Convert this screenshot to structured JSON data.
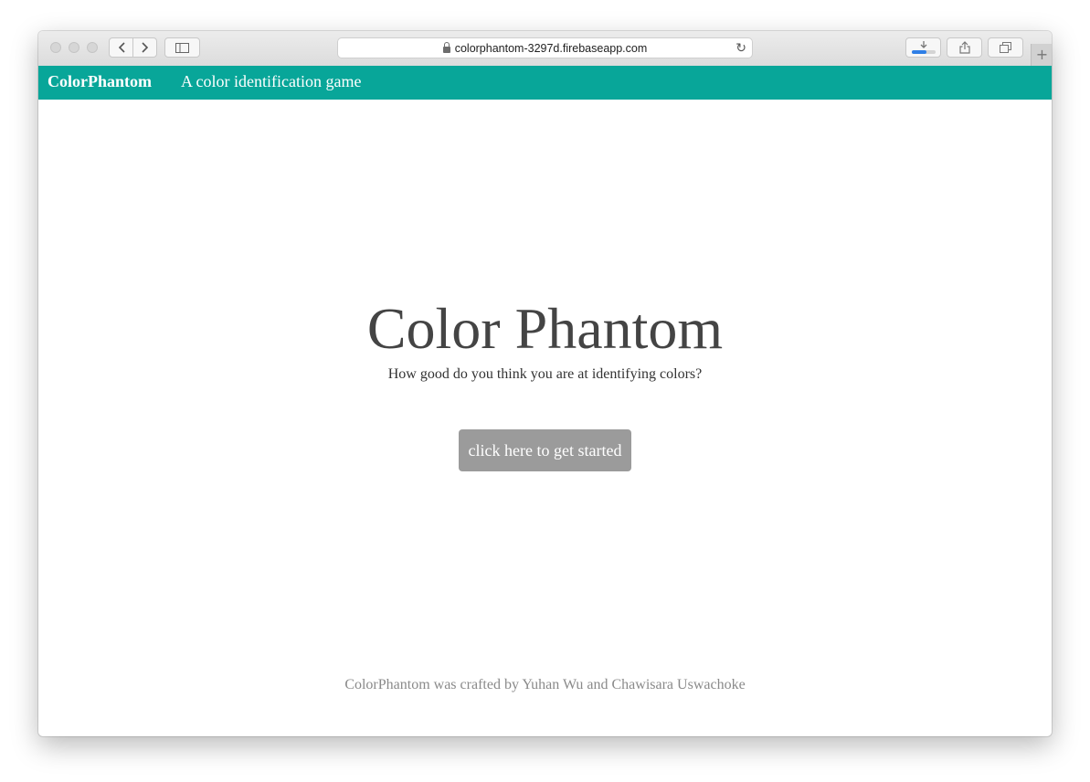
{
  "browser": {
    "url": "colorphantom-3297d.firebaseapp.com",
    "new_tab_label": "+"
  },
  "navbar": {
    "brand": "ColorPhantom",
    "tagline": "A color identification game",
    "background_color": "#08a699"
  },
  "hero": {
    "title": "Color Phantom",
    "subtitle": "How good do you think you are at identifying colors?",
    "start_button": "click here to get started"
  },
  "footer": {
    "credit": "ColorPhantom was crafted by Yuhan Wu and Chawisara Uswachoke"
  },
  "icons": [
    "back-icon",
    "forward-icon",
    "sidebar-icon",
    "lock-icon",
    "reload-icon",
    "download-icon",
    "share-icon",
    "tabs-icon"
  ]
}
